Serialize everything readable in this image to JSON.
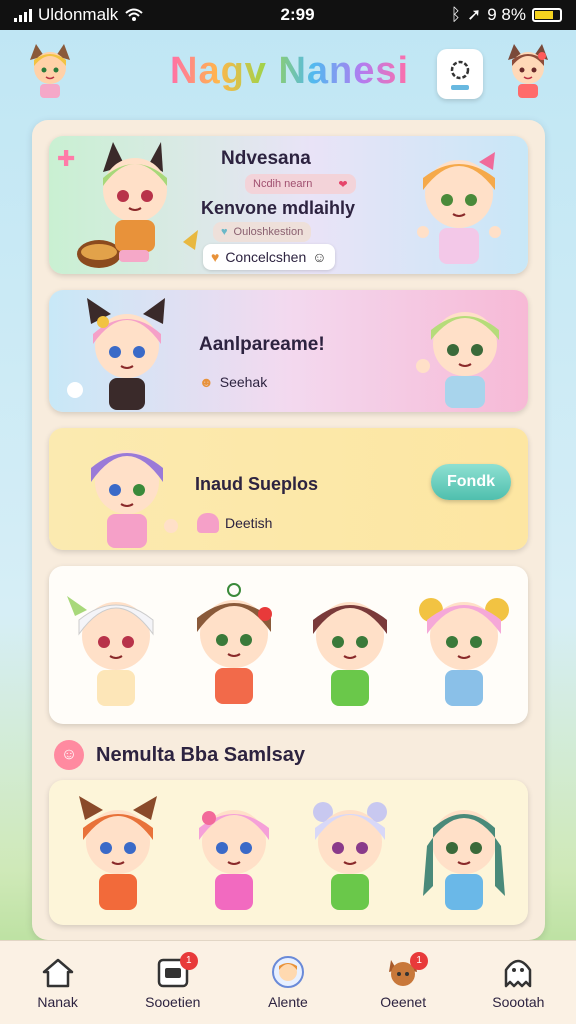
{
  "status_bar": {
    "carrier": "Uldonmalk",
    "time": "2:99",
    "battery": "9 8%"
  },
  "header": {
    "title": "Nagv Nanesi"
  },
  "cards": [
    {
      "title": "Ndvesana",
      "pill1": "Ncdih nearn",
      "subtitle": "Kenvone mdlaihly",
      "pill2": "Ouloshkestion",
      "button_label": "Concelcshen"
    },
    {
      "title": "Aanlpareame!",
      "link": "Seehak"
    },
    {
      "title": "Inaud Sueplos",
      "action": "Fondk",
      "link": "Deetish"
    }
  ],
  "section": {
    "title": "Nemulta Bba Samlsay"
  },
  "nav": [
    {
      "label": "Nanak",
      "icon": "home-icon"
    },
    {
      "label": "Sooetien",
      "icon": "calendar-icon",
      "badge": "1"
    },
    {
      "label": "Alente",
      "icon": "character-icon"
    },
    {
      "label": "Oeenet",
      "icon": "pet-icon",
      "badge": "1"
    },
    {
      "label": "Soootah",
      "icon": "ghost-icon"
    }
  ]
}
